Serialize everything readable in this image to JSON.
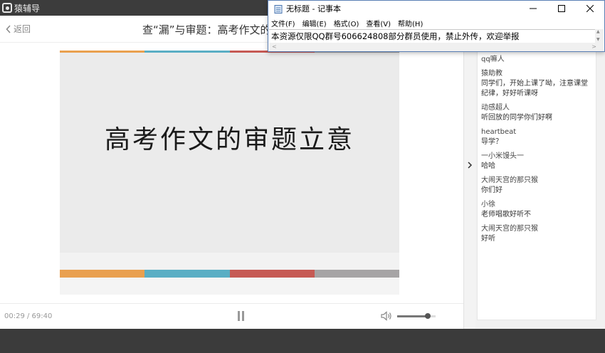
{
  "app": {
    "title": "猿辅导"
  },
  "header": {
    "back_label": "返回",
    "lesson_title": "查“漏”与审题：高考作文的"
  },
  "slide": {
    "heading": "高考作文的审题立意",
    "stripe_colors": [
      "#e9a04f",
      "#5aaec4",
      "#c65a54",
      "#a6a4a5"
    ]
  },
  "player": {
    "time": "00:29 / 69:40",
    "volume_level": 0.8
  },
  "chat": {
    "messages": [
      {
        "name": "qq嘛人",
        "text": ""
      },
      {
        "name": "猿助教",
        "text": "同学们，开始上课了呦，注意课堂纪律，好好听课呀"
      },
      {
        "name": "动感超人",
        "text": "听回放的同学你们好啊"
      },
      {
        "name": "heartbeat",
        "text": "导学？"
      },
      {
        "name": "一小米馒头一",
        "text": "哈哈"
      },
      {
        "name": "大闹天宫的那只猴",
        "text": "你们好"
      },
      {
        "name": "小徐",
        "text": "老师唱歌好听不"
      },
      {
        "name": "大闹天宫的那只猴",
        "text": "好听"
      }
    ]
  },
  "notepad": {
    "title": "无标题 - 记事本",
    "menu": [
      "文件(F)",
      "编辑(E)",
      "格式(O)",
      "查看(V)",
      "帮助(H)"
    ],
    "content": "本资源仅限QQ群号606624808部分群员使用，禁止外传，欢迎举报"
  }
}
